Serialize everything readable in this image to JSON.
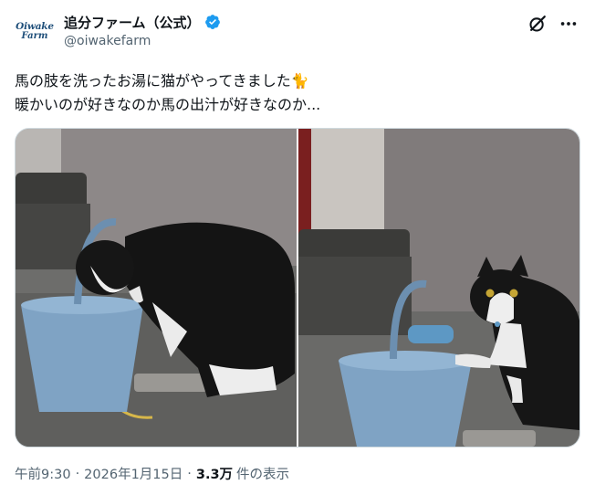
{
  "author": {
    "avatar_line1": "Oiwake",
    "avatar_line2": "Farm",
    "display_name": "追分ファーム（公式）",
    "handle": "@oiwakefarm",
    "verified": true
  },
  "tweet": {
    "line1": "馬の肢を洗ったお湯に猫がやってきました🐈",
    "line2": "暖かいのが好きなのか馬の出汁が好きなのか..."
  },
  "media": {
    "count": 2
  },
  "meta": {
    "time": "午前9:30",
    "separator": "·",
    "date": "2026年1月15日",
    "views_count": "3.3万",
    "views_label": "件の表示"
  },
  "colors": {
    "verified": "#1d9bf0",
    "text": "#0f1419",
    "muted": "#536471",
    "bucket": "#7fa3c4"
  },
  "icons": [
    "verified-badge-icon",
    "grok-icon",
    "more-options-icon"
  ]
}
